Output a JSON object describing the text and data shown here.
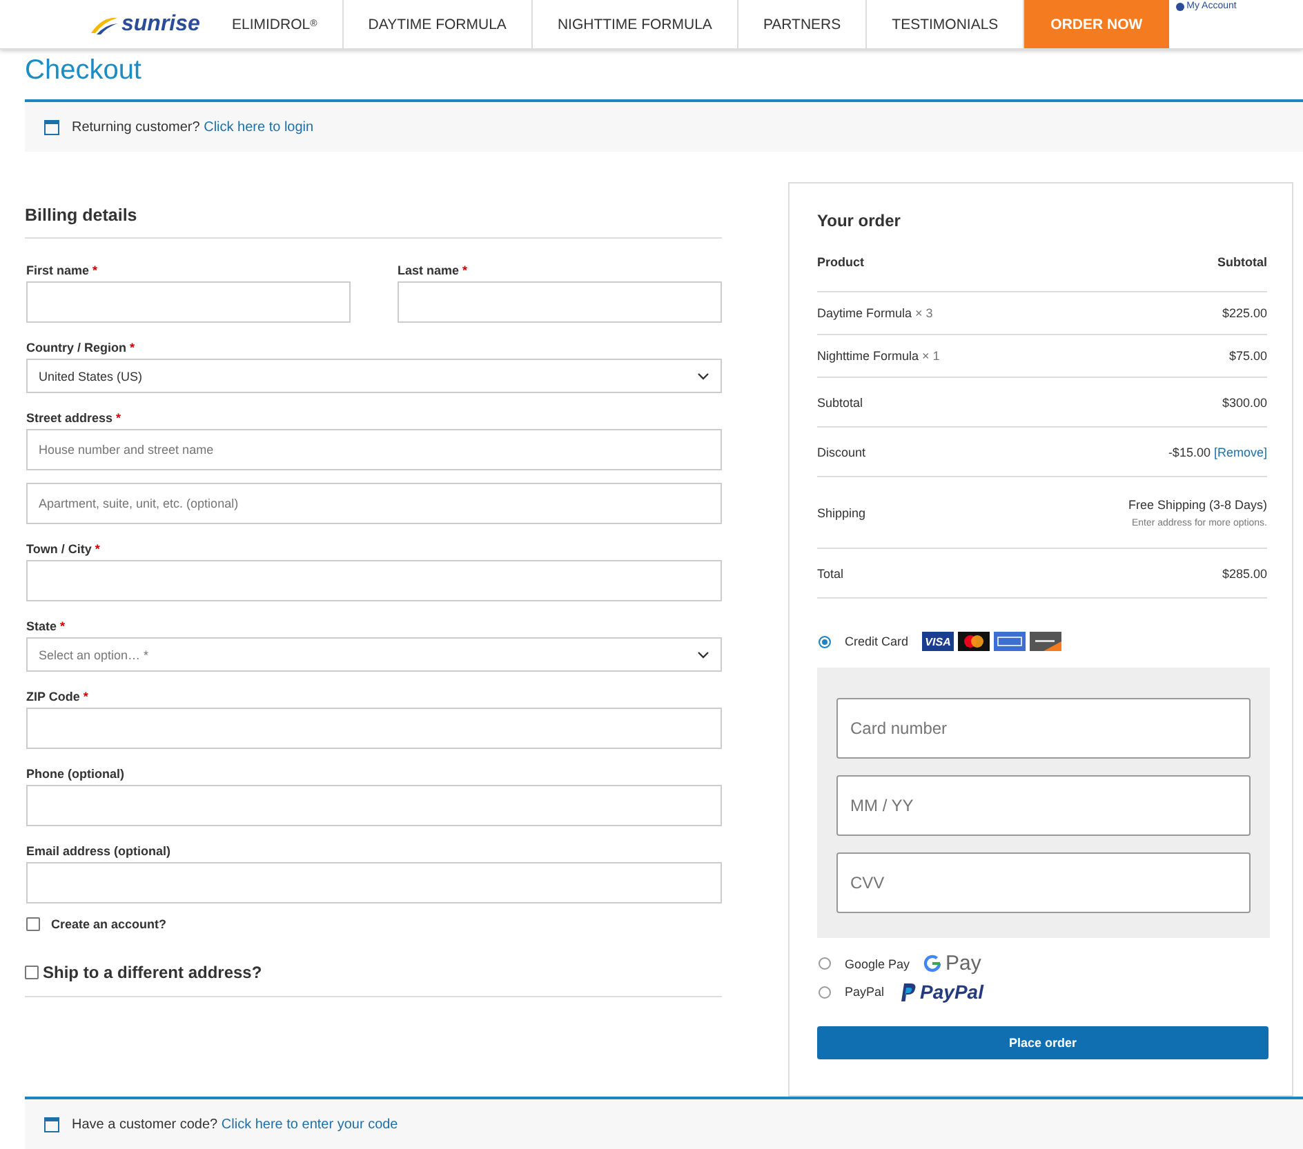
{
  "nav": {
    "brand": "sunrise",
    "items": [
      {
        "label": "ELIMIDROL$^{®}$",
        "kind": "link"
      },
      {
        "label": "DAYTIME FORMULA",
        "kind": "link"
      },
      {
        "label": "NIGHTTIME FORMULA",
        "kind": "link"
      },
      {
        "label": "PARTNERS",
        "kind": "link"
      },
      {
        "label": "TESTIMONIALS",
        "kind": "link"
      },
      {
        "label": "ORDER NOW",
        "kind": "cta"
      }
    ],
    "account": "My Account"
  },
  "page_title": "Checkout",
  "login_notice": {
    "text": "Returning customer?",
    "link": "Click here to login"
  },
  "billing": {
    "title": "Billing details",
    "fields": [
      {
        "kind": "text",
        "label": "First name",
        "mark": "*",
        "half": true
      },
      {
        "kind": "text",
        "label": "Last name",
        "mark": "*",
        "half": true
      },
      {
        "kind": "select",
        "label": "Country / Region",
        "mark": "*",
        "value": "United States (US)"
      },
      {
        "kind": "text",
        "label": "Street address",
        "mark": "*",
        "placeholder": "House number and street name"
      },
      {
        "kind": "text",
        "placeholder": "Apartment, suite, unit, etc. (optional)"
      },
      {
        "kind": "text",
        "label": "Town / City",
        "mark": "*"
      },
      {
        "kind": "select",
        "label": "State",
        "mark": "*",
        "placeholder": "Select an option… *"
      },
      {
        "kind": "text",
        "label": "ZIP Code",
        "mark": "*"
      },
      {
        "kind": "text",
        "label": "Phone (optional)"
      },
      {
        "kind": "text",
        "label": "Email address (optional)"
      }
    ],
    "create_account": {
      "label": "Create an account?",
      "checked": false
    },
    "ship_different": {
      "label": "Ship to a different address?",
      "checked": false
    }
  },
  "order": {
    "title": "Your order",
    "columns": [
      "Product",
      "Subtotal"
    ],
    "rows": [
      {
        "kind": "item",
        "name": "Daytime Formula",
        "qty": "× 3",
        "amount": "$225.00"
      },
      {
        "kind": "item",
        "name": "Nighttime Formula",
        "qty": "× 1",
        "amount": "$75.00"
      },
      {
        "kind": "total",
        "name": "Subtotal",
        "amount": "$300.00"
      },
      {
        "kind": "discount",
        "name": "Discount",
        "amount": "-$15.00",
        "link": "[Remove]"
      },
      {
        "kind": "shipping",
        "name": "Shipping",
        "amount": "Free Shipping (3-8 Days)",
        "note": "Enter address for more options."
      },
      {
        "kind": "total",
        "name": "Total",
        "amount": "$285.00"
      }
    ],
    "payments": [
      {
        "kind": "card",
        "label": "Credit Card",
        "selected": true,
        "logo_text": "VISA"
      },
      {
        "kind": "gpay",
        "label": "Google Pay",
        "selected": false,
        "logo_text": "Pay"
      },
      {
        "kind": "paypal",
        "label": "PayPal",
        "selected": false,
        "logo_text": "PayPal"
      }
    ],
    "card_fields": [
      {
        "placeholder": "Card number"
      },
      {
        "placeholder": "MM / YY"
      },
      {
        "placeholder": "CVV"
      }
    ],
    "button": "Place order"
  },
  "code_notice": {
    "text": "Have a customer code?",
    "link": "Click here to enter your code"
  }
}
